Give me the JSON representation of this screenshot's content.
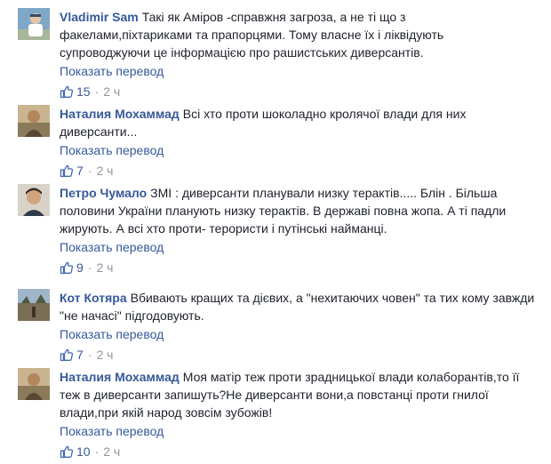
{
  "comments": [
    {
      "author": "Vladimir Sam",
      "text": "Такі як Аміров -справжня загроза, а не ті що з факелами,піхтариками та прапорцями. Тому власне їх і ліквідують супроводжуючи це інформацією про рашистських диверсантів.",
      "translate_label": "Показать перевод",
      "likes": "15",
      "time": "2 ч",
      "avatar_icon": "user-photo-avatar"
    },
    {
      "author": "Наталия Мохаммад",
      "text": "Всі хто проти шоколадно кролячої влади для них диверсанти...",
      "translate_label": "Показать перевод",
      "likes": "7",
      "time": "2 ч",
      "avatar_icon": "user-photo-avatar"
    },
    {
      "author": "Петро Чумало",
      "text": "ЗМІ : диверсанти планували низку терактів..... Блін . Більша половини України планують низку терактів. В державі повна жопа. А ті падли жирують. А всі хто проти- терористи і путінські найманці.",
      "translate_label": "Показать перевод",
      "likes": "9",
      "time": "2 ч",
      "avatar_icon": "user-photo-avatar"
    },
    {
      "author": "Кот Котяра",
      "text": "Вбивають кращих та дієвих, а \"нехитаючих човен\" та тих кому завжди \"не начасі\" підгодовують.",
      "translate_label": "Показать перевод",
      "likes": "7",
      "time": "2 ч",
      "avatar_icon": "user-photo-avatar"
    },
    {
      "author": "Наталия Мохаммад",
      "text": "Моя матір теж проти зрадницької влади колаборантів,то її теж в диверсанти запишуть?Не диверсанти вони,а повстанці проти гнилої влади,при якій народ зовсім зубожів!",
      "translate_label": "Показать перевод",
      "likes": "10",
      "time": "2 ч",
      "avatar_icon": "user-photo-avatar"
    }
  ],
  "separator": "·",
  "colors": {
    "link": "#365899",
    "meta": "#90949c",
    "text": "#1d2129",
    "like_icon": "#4267b2"
  }
}
